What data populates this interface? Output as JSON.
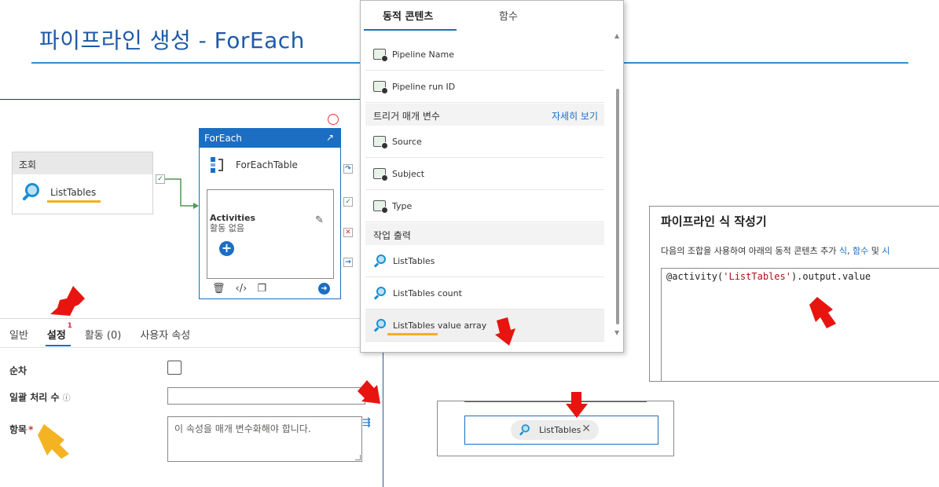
{
  "slide": {
    "title": "파이프라인 생성 - ForEach"
  },
  "pipeline": {
    "lookup": {
      "header": "조회",
      "name": "ListTables"
    },
    "foreach": {
      "header": "ForEach",
      "name": "ForEachTable",
      "activities_title": "Activities",
      "activities_sub": "활동 없음"
    }
  },
  "properties": {
    "tabs": [
      {
        "label": "일반",
        "active": false
      },
      {
        "label": "설정",
        "active": true,
        "badge": "1"
      },
      {
        "label": "활동 (0)",
        "active": false
      },
      {
        "label": "사용자 속성",
        "active": false
      }
    ],
    "fields": {
      "sequential_label": "순차",
      "batch_count_label": "일괄 처리 수",
      "batch_count_info": "ⓘ",
      "items_label": "항목",
      "items_required": "*",
      "items_placeholder": "이 속성을 매개 변수화해야 합니다."
    }
  },
  "dynamic_content": {
    "tabs": [
      "동적 콘텐츠",
      "함수"
    ],
    "system_items": [
      "Pipeline Name",
      "Pipeline run ID"
    ],
    "trigger_section": {
      "label": "트리거 매개 변수",
      "more_link": "자세히 보기"
    },
    "trigger_items": [
      "Source",
      "Subject",
      "Type"
    ],
    "output_section": {
      "label": "작업 출력"
    },
    "output_items": [
      "ListTables",
      "ListTables count",
      "ListTables value array"
    ]
  },
  "expression_builder": {
    "title": "파이프라인 식 작성기",
    "description_prefix": "다음의 조합을 사용하여 아래의 동적 콘텐츠 추가 ",
    "link1": "식",
    "sep": ", ",
    "link2": "함수",
    "and": " 및 ",
    "link3": "시",
    "code_prefix": "@activity(",
    "code_string": "'ListTables'",
    "code_suffix": ").output.value"
  },
  "chip_panel": {
    "chip_label": "ListTables",
    "chip_remove": "✕"
  },
  "colors": {
    "title_blue": "#1e5aa8",
    "accent_blue": "#1b6ec2",
    "highlight_yellow": "#f2b11b",
    "arrow_red": "#e8140f",
    "arrow_orange": "#f5b324"
  }
}
